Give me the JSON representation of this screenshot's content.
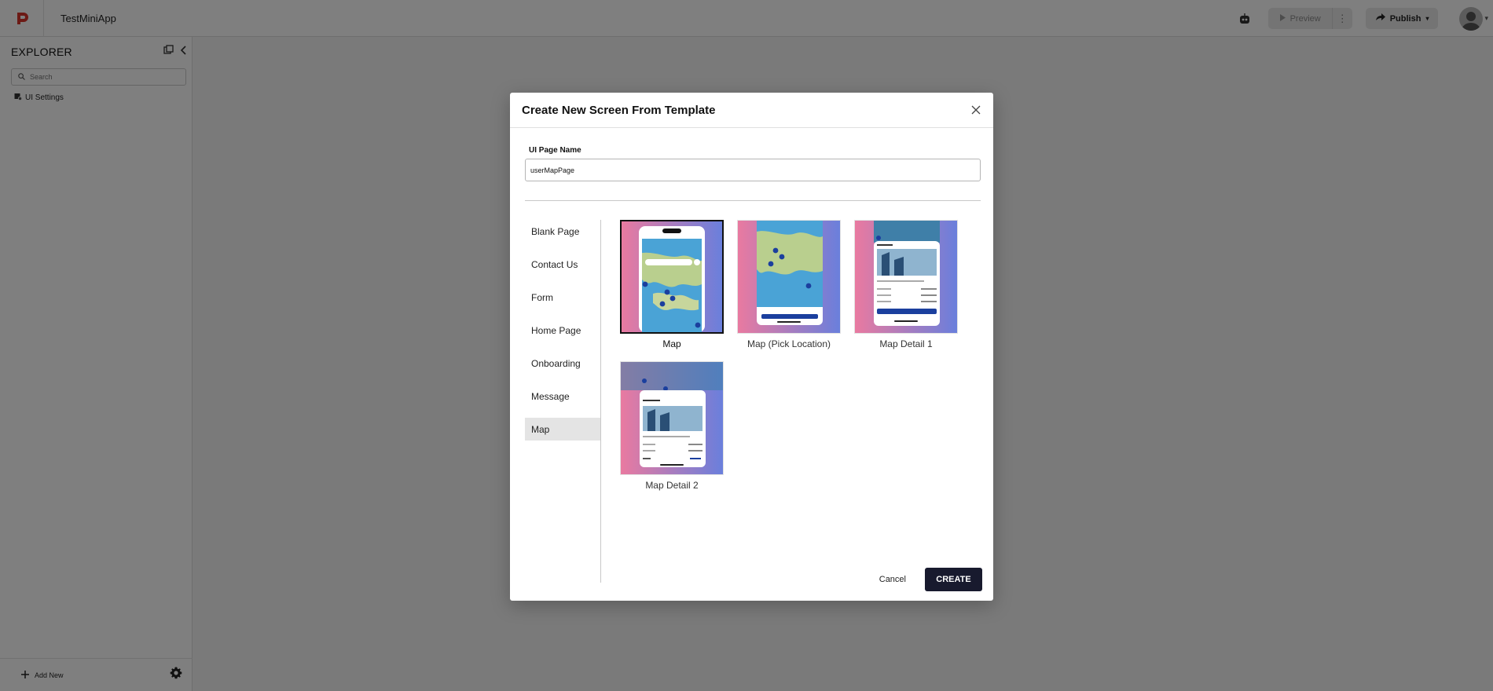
{
  "topbar": {
    "app_title": "TestMiniApp",
    "preview_label": "Preview",
    "publish_label": "Publish"
  },
  "sidebar": {
    "title": "EXPLORER",
    "search_placeholder": "Search",
    "tree_items": [
      "UI Settings"
    ],
    "add_new_label": "Add New"
  },
  "dialog": {
    "title": "Create New Screen From Template",
    "page_name_label": "UI Page Name",
    "page_name_value": "userMapPage",
    "categories": [
      "Blank Page",
      "Contact Us",
      "Form",
      "Home Page",
      "Onboarding",
      "Message",
      "Map"
    ],
    "active_category": "Map",
    "templates": [
      "Map",
      "Map (Pick Location)",
      "Map Detail 1",
      "Map Detail 2"
    ],
    "selected_template": "Map",
    "cancel_label": "Cancel",
    "create_label": "CREATE"
  },
  "colors": {
    "create_button": "#181a2e",
    "logo_accent": "#d9342b",
    "thumb_gradient_left": "#e97aa0",
    "thumb_gradient_right": "#6a7fdc",
    "map_sea": "#4aa3d6",
    "map_land": "#b9cf8e",
    "pin": "#1b3f9e"
  },
  "icons": {
    "logo": "app-logo-icon",
    "robot": "robot-icon",
    "play": "play-icon",
    "more": "more-vertical-icon",
    "share": "share-arrow-icon",
    "user": "user-avatar-icon",
    "copy": "copy-icon",
    "collapse": "chevron-left-icon",
    "search": "search-icon",
    "ui_settings": "ui-settings-icon",
    "plus": "plus-icon",
    "gear": "gear-icon",
    "close": "close-icon"
  }
}
